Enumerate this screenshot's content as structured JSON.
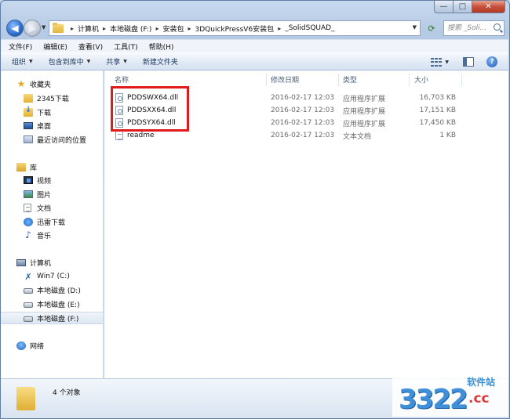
{
  "window": {
    "caption_buttons": {
      "minimize": "—",
      "maximize": "□",
      "close": "✕"
    }
  },
  "address": {
    "breadcrumbs": [
      "计算机",
      "本地磁盘 (F:)",
      "安装包",
      "3DQuickPressV6安装包",
      "_SolidSQUAD_"
    ],
    "search_placeholder": "搜索 _Soli..."
  },
  "menu": [
    "文件(F)",
    "编辑(E)",
    "查看(V)",
    "工具(T)",
    "帮助(H)"
  ],
  "toolbar": {
    "organize": "组织",
    "include_in_library": "包含到库中",
    "share": "共享",
    "new_folder": "新建文件夹"
  },
  "nav": {
    "favorites": "收藏夹",
    "favorites_items": [
      "2345下载",
      "下载",
      "桌面",
      "最近访问的位置"
    ],
    "libraries": "库",
    "library_items": [
      "视频",
      "图片",
      "文档",
      "迅雷下载",
      "音乐"
    ],
    "computer": "计算机",
    "computer_items": [
      "Win7 (C:)",
      "本地磁盘 (D:)",
      "本地磁盘 (E:)",
      "本地磁盘 (F:)"
    ],
    "network": "网络"
  },
  "columns": {
    "name": "名称",
    "date": "修改日期",
    "type": "类型",
    "size": "大小"
  },
  "files": [
    {
      "name": "PDDSWX64.dll",
      "date": "2016-02-17 12:03",
      "type": "应用程序扩展",
      "size": "16,703 KB"
    },
    {
      "name": "PDDSXX64.dll",
      "date": "2016-02-17 12:03",
      "type": "应用程序扩展",
      "size": "17,151 KB"
    },
    {
      "name": "PDDSYX64.dll",
      "date": "2016-02-17 12:03",
      "type": "应用程序扩展",
      "size": "17,450 KB"
    },
    {
      "name": "readme",
      "date": "2016-02-17 12:03",
      "type": "文本文档",
      "size": "1 KB"
    }
  ],
  "status": {
    "count": "4 个对象"
  },
  "watermark": {
    "number": "3322",
    "tag": "软件站",
    "domain": ".cc"
  }
}
